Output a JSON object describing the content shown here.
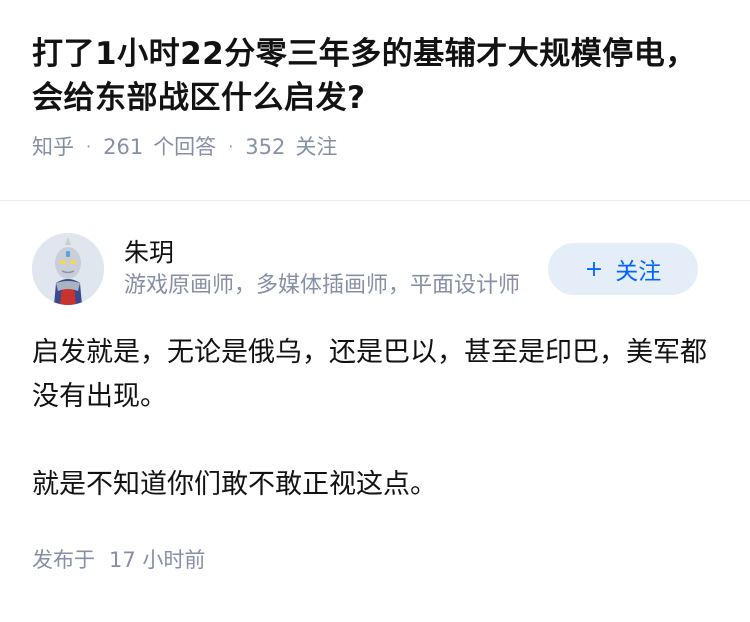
{
  "question": {
    "title": "打了1小时22分零三年多的基辅才大规模停电，会给东部战区什么启发?",
    "source": "知乎",
    "answer_count": "261",
    "answer_label": "个回答",
    "follower_count": "352",
    "follower_label": "关注"
  },
  "author": {
    "name": "朱玥",
    "description": "游戏原画师，多媒体插画师，平面设计师",
    "avatar": "avatar-icon",
    "follow_plus": "+",
    "follow_label": "关注"
  },
  "answer": {
    "paragraphs": [
      "启发就是，无论是俄乌，还是巴以，甚至是印巴，美军都没有出现。",
      "就是不知道你们敢不敢正视这点。"
    ],
    "publish_label": "发布于",
    "publish_time": "17 小时前"
  },
  "colors": {
    "accent": "#0066ff",
    "button_bg": "#e5eef8",
    "meta_gray": "#8590a6",
    "text": "#121212"
  }
}
